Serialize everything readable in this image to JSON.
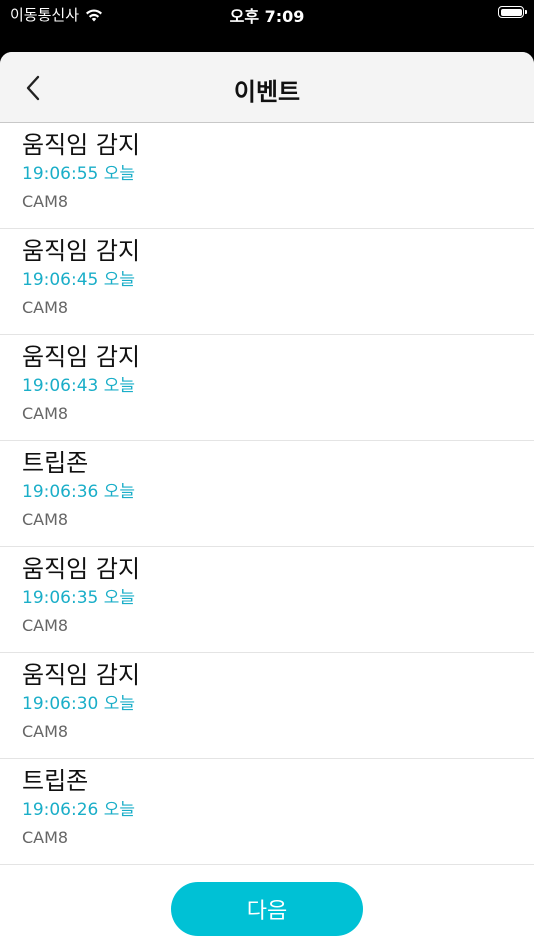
{
  "status_bar": {
    "carrier": "이동통신사",
    "time": "오후 7:09",
    "battery_level": 1.0
  },
  "nav": {
    "title": "이벤트",
    "back_icon": "chevron-left-icon"
  },
  "events": [
    {
      "title": "움직임 감지",
      "time": "19:06:55 오늘",
      "camera": "CAM8"
    },
    {
      "title": "움직임 감지",
      "time": "19:06:45 오늘",
      "camera": "CAM8"
    },
    {
      "title": "움직임 감지",
      "time": "19:06:43 오늘",
      "camera": "CAM8"
    },
    {
      "title": "트립존",
      "time": "19:06:36 오늘",
      "camera": "CAM8"
    },
    {
      "title": "움직임 감지",
      "time": "19:06:35 오늘",
      "camera": "CAM8"
    },
    {
      "title": "움직임 감지",
      "time": "19:06:30 오늘",
      "camera": "CAM8"
    },
    {
      "title": "트립존",
      "time": "19:06:26 오늘",
      "camera": "CAM8"
    }
  ],
  "footer": {
    "next_label": "다음"
  },
  "colors": {
    "accent": "#00c1d5",
    "time_text": "#1aaec8",
    "status_bar_bg": "#000000"
  }
}
